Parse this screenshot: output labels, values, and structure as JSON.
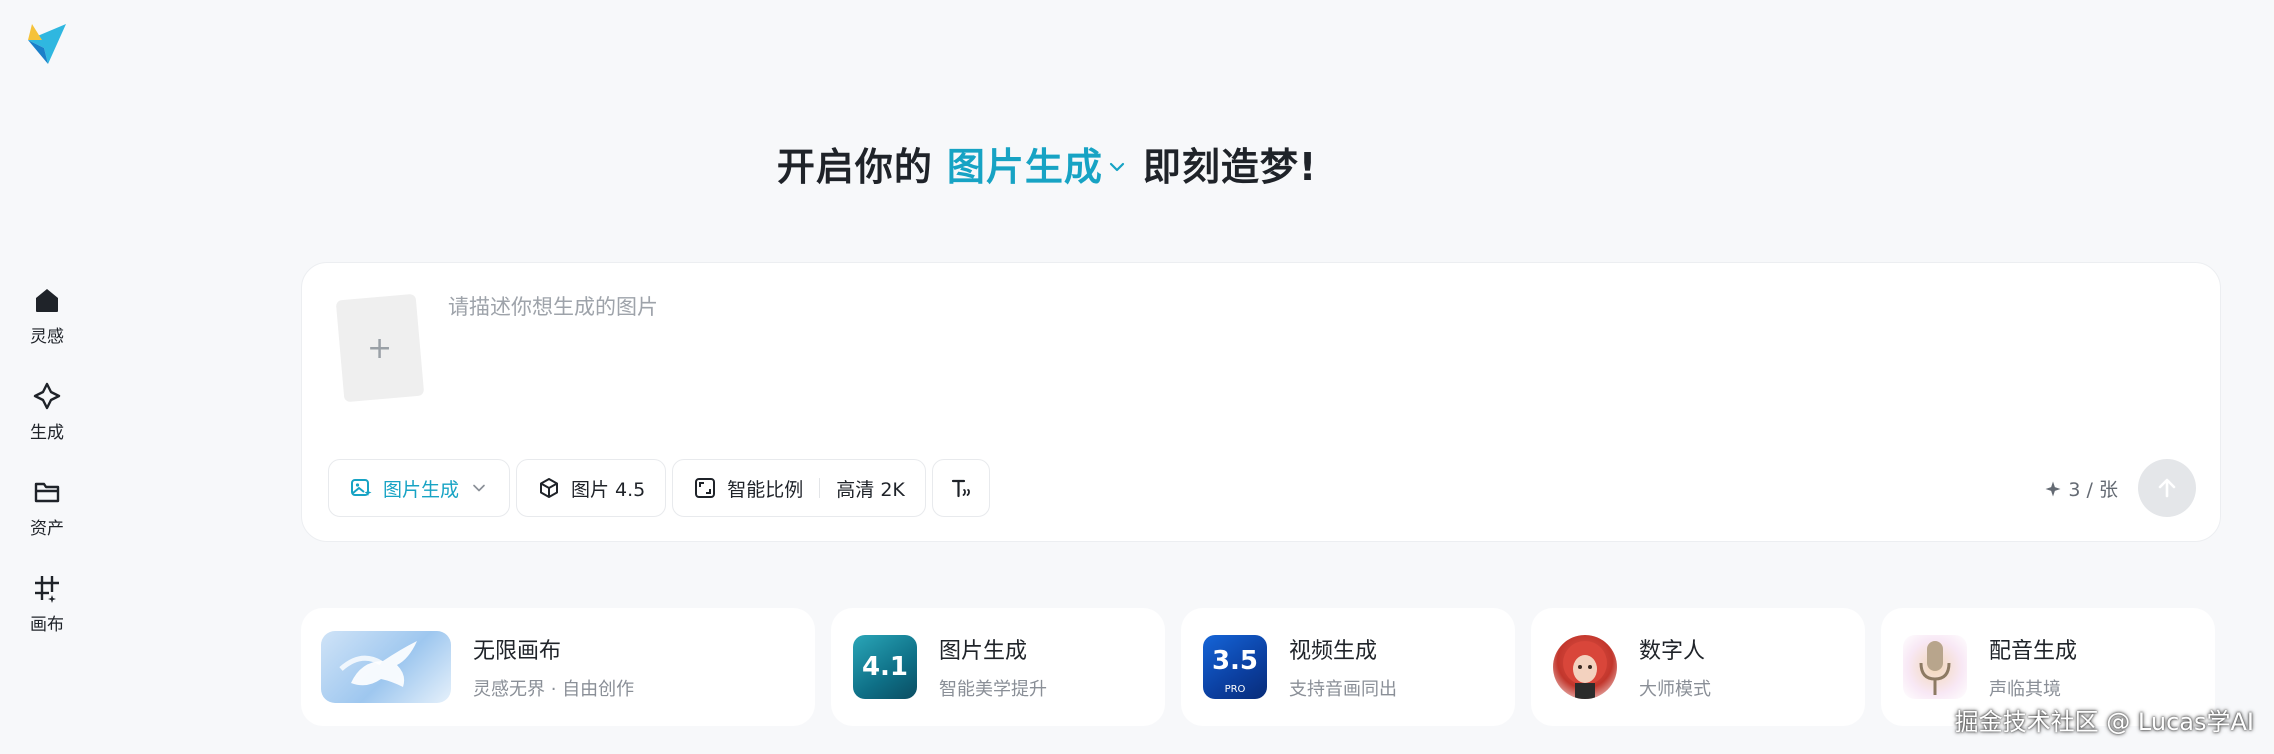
{
  "sidebar": {
    "items": [
      {
        "label": "灵感",
        "icon": "home-icon"
      },
      {
        "label": "生成",
        "icon": "sparkle-icon"
      },
      {
        "label": "资产",
        "icon": "folder-icon"
      },
      {
        "label": "画布",
        "icon": "canvas-icon"
      }
    ]
  },
  "headline": {
    "prefix": "开启你的",
    "mode": "图片生成",
    "suffix": "即刻造梦!"
  },
  "composer": {
    "upload_symbol": "+",
    "placeholder": "请描述你想生成的图片",
    "value": "",
    "mode_chip": "图片生成",
    "model_chip": "图片 4.5",
    "ratio_label": "智能比例",
    "quality_label": "高清 2K",
    "credit_text": "3 / 张"
  },
  "cards": [
    {
      "title": "无限画布",
      "subtitle": "灵感无界 · 自由创作"
    },
    {
      "title": "图片生成",
      "subtitle": "智能美学提升",
      "badge": "4.1"
    },
    {
      "title": "视频生成",
      "subtitle": "支持音画同出",
      "badge": "3.5",
      "badge_sub": "PRO"
    },
    {
      "title": "数字人",
      "subtitle": "大师模式"
    },
    {
      "title": "配音生成",
      "subtitle": "声临其境"
    }
  ],
  "watermark": "掘金技术社区 @ Lucas学AI",
  "colors": {
    "accent": "#17a3c4",
    "background": "#f7f8fa",
    "card": "#ffffff"
  }
}
